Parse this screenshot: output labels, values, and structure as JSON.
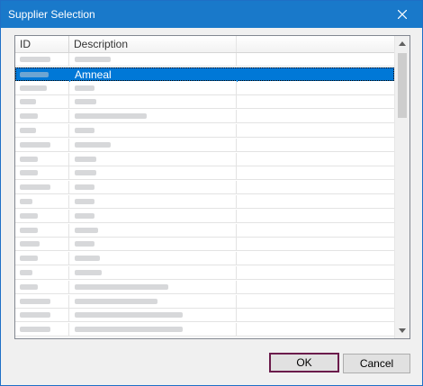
{
  "window": {
    "title": "Supplier Selection",
    "close_icon": "close-icon"
  },
  "list": {
    "columns": [
      {
        "label": "ID"
      },
      {
        "label": "Description"
      }
    ],
    "selected_row": {
      "description": "Amneal"
    },
    "colors": {
      "selection": "#0078d7",
      "titlebar": "#1979ca",
      "ok_border": "#6b1b4b"
    }
  },
  "buttons": {
    "ok_label": "OK",
    "cancel_label": "Cancel"
  }
}
